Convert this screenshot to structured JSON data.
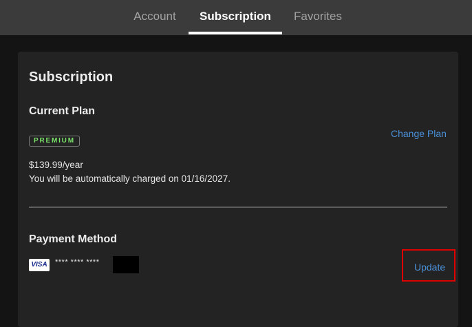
{
  "tabs": [
    {
      "label": "Account"
    },
    {
      "label": "Subscription"
    },
    {
      "label": "Favorites"
    }
  ],
  "card": {
    "title": "Subscription",
    "current_plan": {
      "heading": "Current Plan",
      "badge": "PREMIUM",
      "price": "$139.99/year",
      "charge_note": "You will be automatically charged on 01/16/2027.",
      "change_plan_label": "Change Plan"
    },
    "payment_method": {
      "heading": "Payment Method",
      "card_brand": "VISA",
      "masked_number": "**** **** ****",
      "update_label": "Update"
    }
  },
  "colors": {
    "accent_link": "#4a90d9",
    "badge_text": "#7be36a",
    "highlight_box": "#e00000"
  }
}
